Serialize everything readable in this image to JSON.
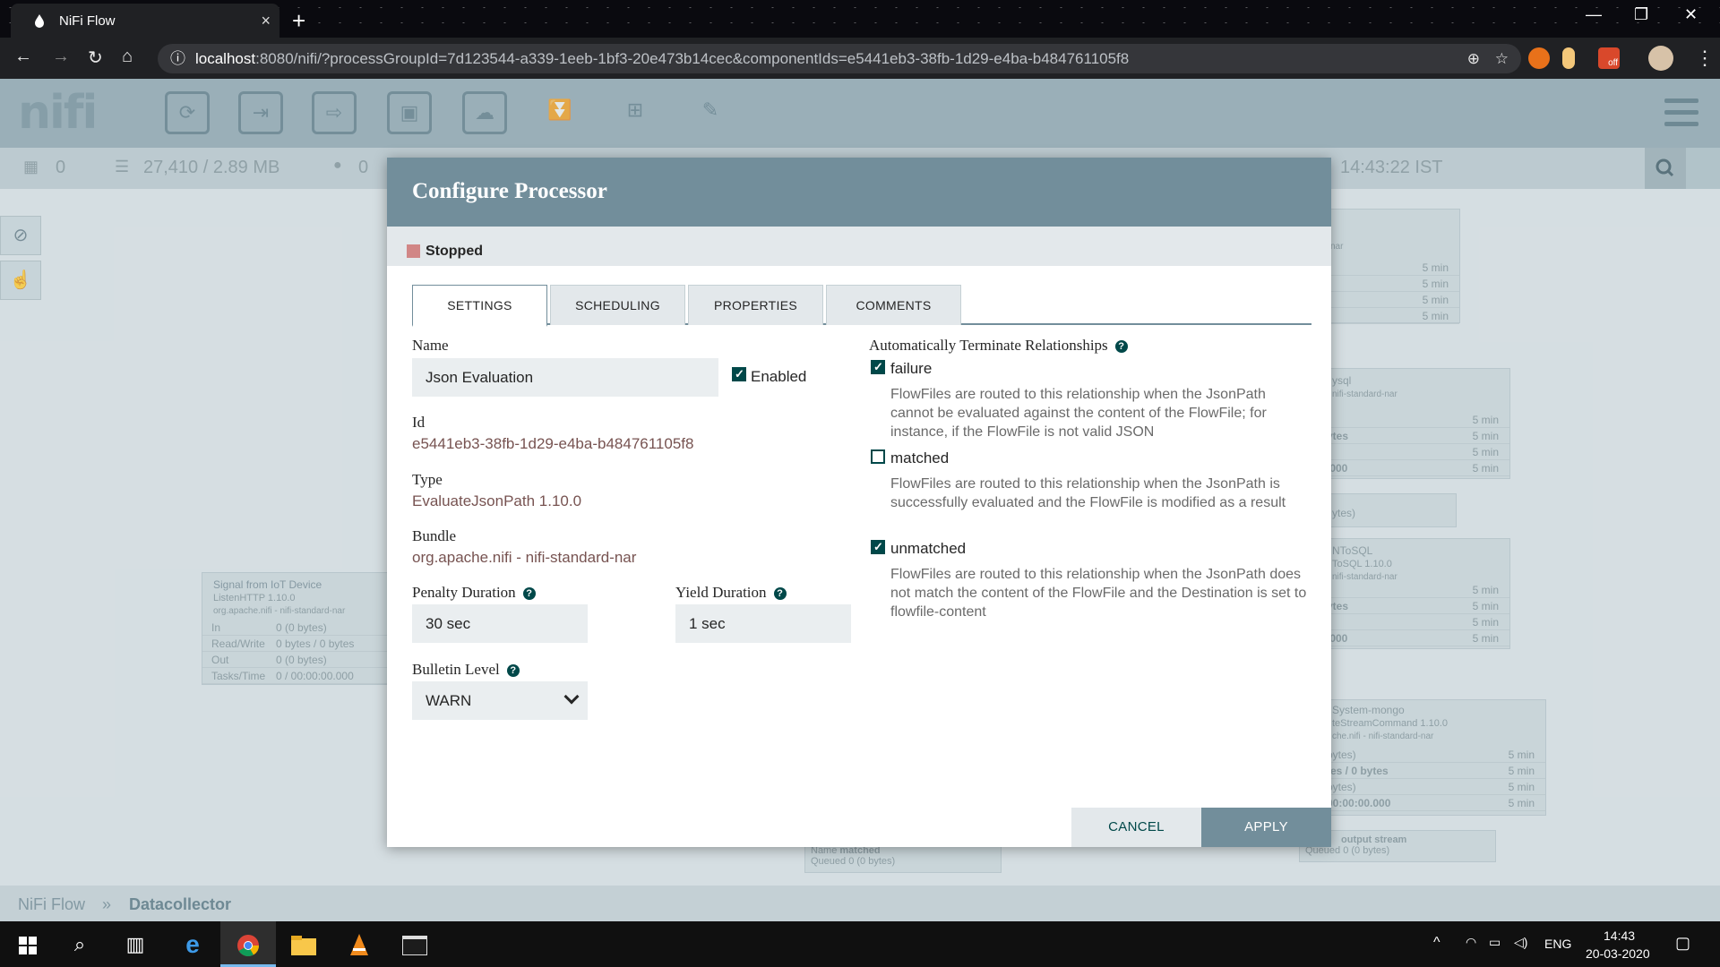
{
  "browser": {
    "tab_title": "NiFi Flow",
    "tab_close": "×",
    "new_tab": "+",
    "url_host": "localhost",
    "url_rest": ":8080/nifi/?processGroupId=7d123544-a339-1eeb-1bf3-20e473b14cec&componentIds=e5441eb3-38fb-1d29-e4ba-b484761105f8",
    "minimize": "—",
    "restore": "❐",
    "close": "✕",
    "back": "←",
    "forward": "→",
    "reload": "↻",
    "home": "⌂",
    "info": "ⓘ",
    "zoom": "⊕",
    "star": "☆",
    "ext_off_label": "off"
  },
  "toolbar": {
    "logo": "nifi",
    "tools": [
      {
        "name": "processor",
        "glyph": "⟳"
      },
      {
        "name": "input-port",
        "glyph": "⇥"
      },
      {
        "name": "output-port",
        "glyph": "⇨"
      },
      {
        "name": "process-group",
        "glyph": "▣"
      },
      {
        "name": "remote-process-group",
        "glyph": "☁"
      },
      {
        "name": "funnel",
        "glyph": "⏬"
      },
      {
        "name": "template",
        "glyph": "⊞"
      },
      {
        "name": "label",
        "glyph": "✎"
      }
    ]
  },
  "status": {
    "transmitting": "0",
    "queued": "27,410 / 2.89 MB",
    "remote": "0",
    "time": "14:43:22 IST"
  },
  "breadcrumb": {
    "root": "NiFi Flow",
    "separator": "»",
    "current": "Datacollector"
  },
  "background_processors": {
    "listen": {
      "name": "Signal from IoT Device",
      "type": "ListenHTTP 1.10.0",
      "bundle": "org.apache.nifi - nifi-standard-nar",
      "rows": [
        {
          "label": "In",
          "value": "0 (0 bytes)"
        },
        {
          "label": "Read/Write",
          "value": "0 bytes / 0 bytes"
        },
        {
          "label": "Out",
          "value": "0 (0 bytes)"
        },
        {
          "label": "Tasks/Time",
          "value": "0 / 00:00:00.000"
        }
      ]
    },
    "five_min": "5 min",
    "mysql_label": "ysql",
    "mysql_bundle": "nifi-standard-nar",
    "tosql_label": "NToSQL",
    "tosql_type": "ToSQL 1.10.0",
    "tosql_bundle": "nifi-standard-nar",
    "bytes_label": "ytes",
    "bytes_paren": "ytes)",
    "zero_label": ".000",
    "top_bundle": "nar",
    "mongo_name": "System-mongo",
    "mongo_type": "teStreamCommand 1.10.0",
    "mongo_bundle": "che.nifi - nifi-standard-nar",
    "mongo_rows": [
      "bytes)",
      "tes / 0 bytes",
      "bytes)",
      "00:00:00.000"
    ],
    "connection": {
      "name_label": "Name",
      "name": "matched",
      "queued_label": "Queued",
      "queued": "0 (0 bytes)"
    },
    "output": {
      "name": "output stream",
      "queued_label": "Queued",
      "queued": "0 (0 bytes)"
    }
  },
  "dialog": {
    "title": "Configure Processor",
    "status": "Stopped",
    "tabs": [
      "SETTINGS",
      "SCHEDULING",
      "PROPERTIES",
      "COMMENTS"
    ],
    "name_label": "Name",
    "name_value": "Json Evaluation",
    "enabled_label": "Enabled",
    "id_label": "Id",
    "id_value": "e5441eb3-38fb-1d29-e4ba-b484761105f8",
    "type_label": "Type",
    "type_value": "EvaluateJsonPath 1.10.0",
    "bundle_label": "Bundle",
    "bundle_value": "org.apache.nifi - nifi-standard-nar",
    "penalty_label": "Penalty Duration",
    "penalty_value": "30 sec",
    "yield_label": "Yield Duration",
    "yield_value": "1 sec",
    "bulletin_label": "Bulletin Level",
    "bulletin_value": "WARN",
    "help_glyph": "?",
    "auto_terminate_label": "Automatically Terminate Relationships",
    "relationships": [
      {
        "name": "failure",
        "checked": true,
        "desc": "FlowFiles are routed to this relationship when the JsonPath cannot be evaluated against the content of the FlowFile; for instance, if the FlowFile is not valid JSON"
      },
      {
        "name": "matched",
        "checked": false,
        "desc": "FlowFiles are routed to this relationship when the JsonPath is successfully evaluated and the FlowFile is modified as a result"
      },
      {
        "name": "unmatched",
        "checked": true,
        "desc": "FlowFiles are routed to this relationship when the JsonPath does not match the content of the FlowFile and the Destination is set to flowfile-content"
      }
    ],
    "cancel_label": "CANCEL",
    "apply_label": "APPLY"
  },
  "taskbar": {
    "language": "ENG",
    "time": "14:43",
    "date": "20-03-2020",
    "tray_up": "^"
  }
}
